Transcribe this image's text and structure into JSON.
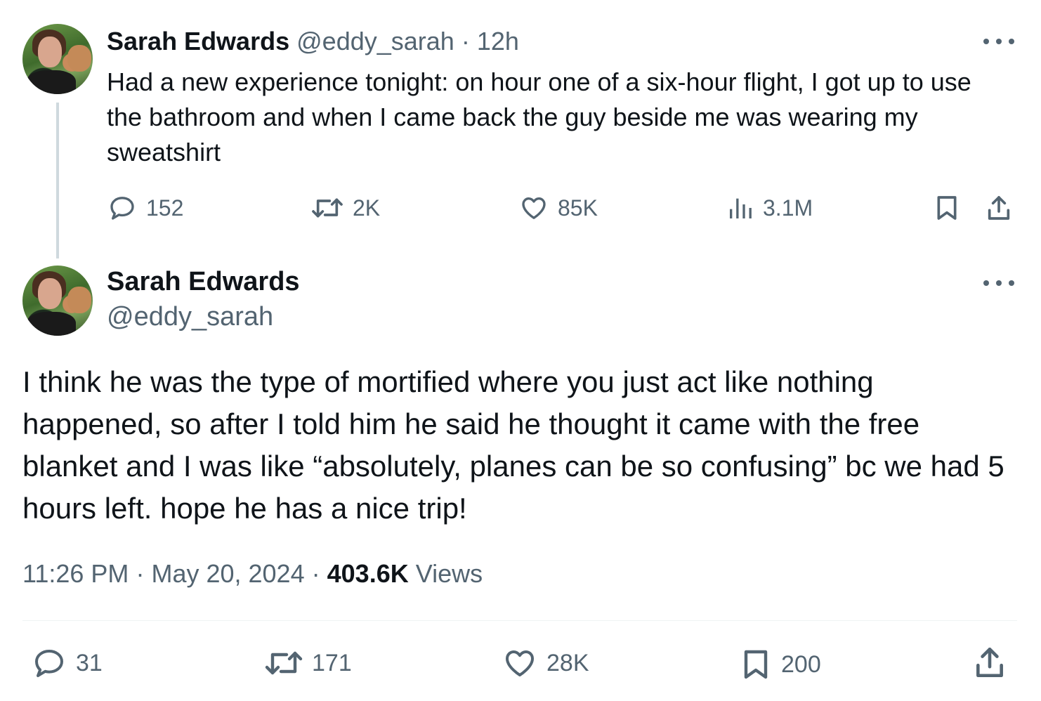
{
  "parent_tweet": {
    "author_name": "Sarah Edwards",
    "handle": "@eddy_sarah",
    "separator": "·",
    "time_ago": "12h",
    "text": "Had a new experience tonight: on hour one of a six-hour flight, I got up to use the bathroom and when I came back the guy beside me was wearing my sweatshirt",
    "replies": "152",
    "reposts": "2K",
    "likes": "85K",
    "views": "3.1M"
  },
  "main_tweet": {
    "author_name": "Sarah Edwards",
    "handle": "@eddy_sarah",
    "text": "I think he was the type of mortified where you just act like nothing happened, so after I told him he said he thought it came with the free blanket and I was like “absolutely, planes can be so confusing” bc we had 5 hours left. hope he has a nice trip!",
    "time": "11:26 PM",
    "separator": "·",
    "date": "May 20, 2024",
    "view_count": "403.6K",
    "views_label": "Views",
    "replies": "31",
    "reposts": "171",
    "likes": "28K",
    "bookmarks": "200"
  },
  "icons": {
    "reply": "speech-bubble-icon",
    "repost": "repost-arrows-icon",
    "like": "heart-icon",
    "views": "bar-chart-icon",
    "bookmark": "bookmark-icon",
    "share": "share-upload-icon",
    "more": "more-dots-icon"
  },
  "colors": {
    "text": "#0f1419",
    "muted": "#536471",
    "thread_line": "#cfd9de",
    "divider": "#eff3f4"
  }
}
